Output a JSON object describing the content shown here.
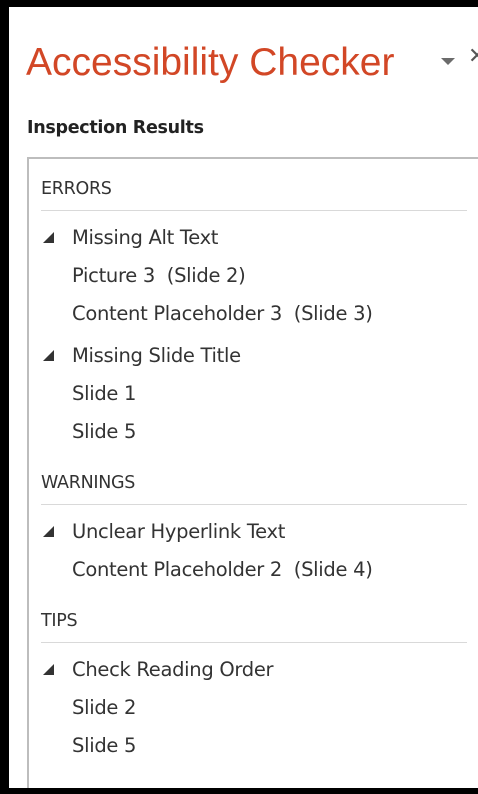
{
  "pane": {
    "title": "Accessibility Checker",
    "menu_icon": "dropdown-triangle-icon",
    "close_icon": "close-icon",
    "close_glyph": "✕",
    "title_color": "#d24726"
  },
  "inspection": {
    "label": "Inspection Results"
  },
  "groups": [
    {
      "header": "ERRORS",
      "issues": [
        {
          "label": "Missing Alt Text",
          "items": [
            "Picture 3  (Slide 2)",
            "Content Placeholder 3  (Slide 3)"
          ]
        },
        {
          "label": "Missing Slide Title",
          "items": [
            "Slide 1",
            "Slide 5"
          ]
        }
      ]
    },
    {
      "header": "WARNINGS",
      "issues": [
        {
          "label": "Unclear Hyperlink Text",
          "items": [
            "Content Placeholder 2  (Slide 4)"
          ]
        }
      ]
    },
    {
      "header": "TIPS",
      "issues": [
        {
          "label": "Check Reading Order",
          "items": [
            "Slide 2",
            "Slide 5"
          ]
        }
      ]
    }
  ]
}
